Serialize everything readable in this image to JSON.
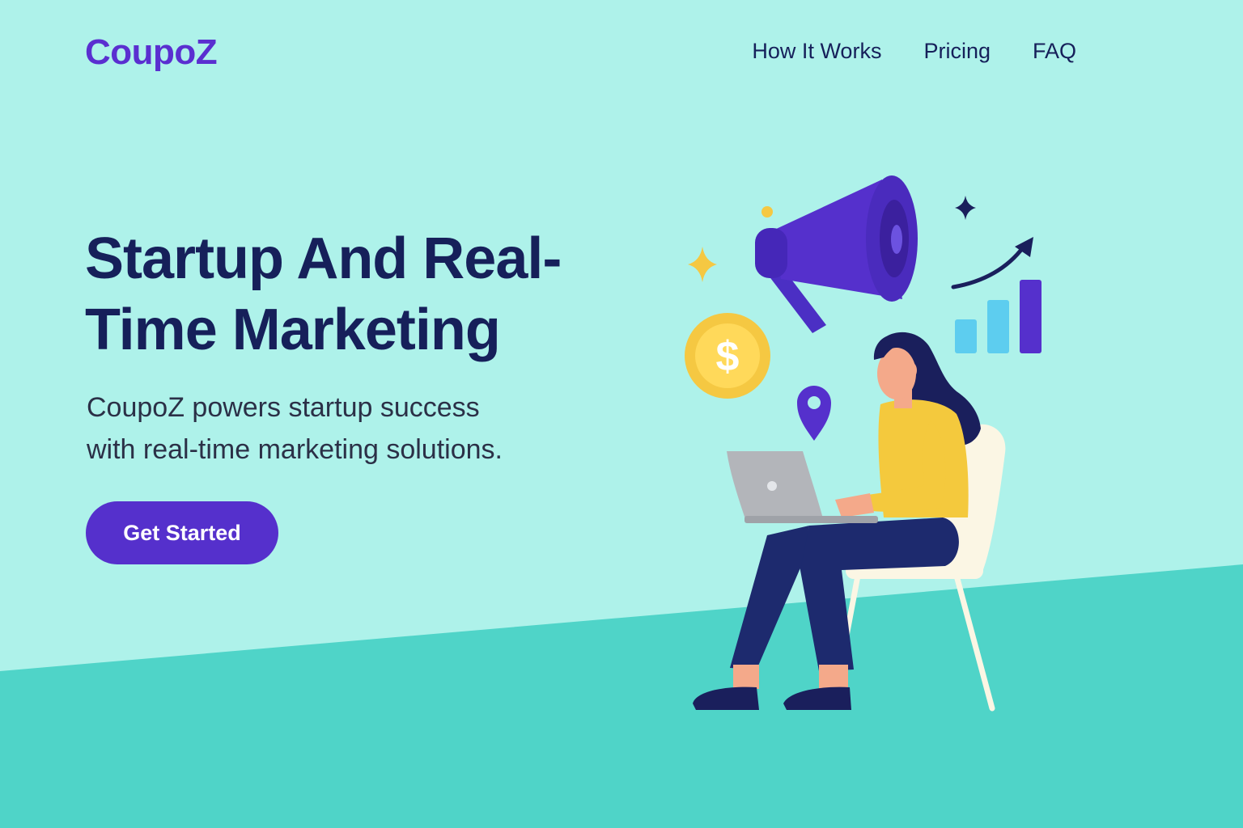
{
  "brand": {
    "logo_text": "CoupoZ",
    "color": "#5a2fd0"
  },
  "nav": {
    "items": [
      {
        "label": "How It Works"
      },
      {
        "label": "Pricing"
      },
      {
        "label": "FAQ"
      }
    ]
  },
  "hero": {
    "headline_line1": "Startup And Real-",
    "headline_line2": "Time Marketing",
    "subtitle_line1": "CoupoZ powers startup success",
    "subtitle_line2": "with real-time marketing solutions.",
    "cta_label": "Get Started"
  },
  "theme": {
    "background": "#aef2ea",
    "ground": "#4fd4c8",
    "accent": "#5530cc",
    "text_dark": "#16205a"
  },
  "illustration": {
    "icons": [
      "megaphone-icon",
      "dollar-coin-icon",
      "location-pin-icon",
      "sparkle-icon",
      "trend-arrow-icon",
      "bar-chart-icon"
    ],
    "figure": "woman-with-laptop"
  }
}
